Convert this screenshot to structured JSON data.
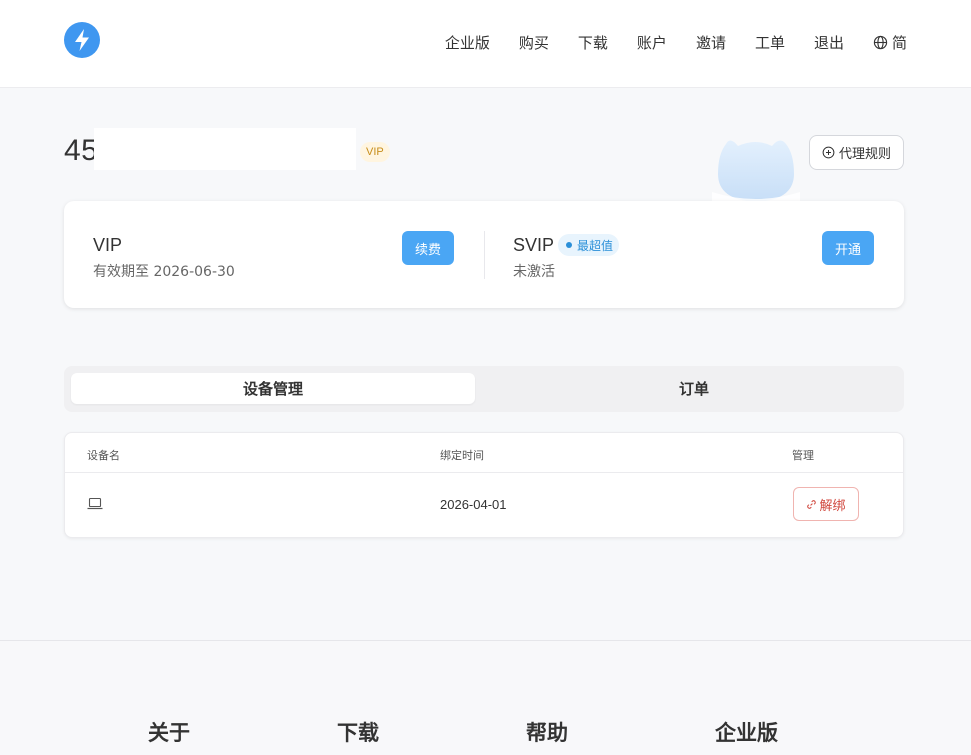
{
  "header": {
    "logo_icon": "bolt-icon",
    "brand_color": "#3f97f0",
    "nav": [
      "企业版",
      "购买",
      "下载",
      "账户",
      "邀请",
      "工单",
      "退出"
    ],
    "lang_icon": "globe-icon",
    "lang_label": "简"
  },
  "account": {
    "username_prefix": "45",
    "badge": "VIP",
    "proxy_rules_label": "代理规则"
  },
  "plans": {
    "vip": {
      "name": "VIP",
      "status": "有效期至 2026-06-30",
      "button": "续费"
    },
    "svip": {
      "name": "SVIP",
      "badge": "最超值",
      "status": "未激活",
      "button": "开通"
    },
    "accent_color": "#4aa6f4"
  },
  "tabs": [
    {
      "label": "设备管理",
      "active": true
    },
    {
      "label": "订单",
      "active": false
    }
  ],
  "devices": {
    "columns": [
      "设备名",
      "绑定时间",
      "管理"
    ],
    "rows": [
      {
        "device_icon": "laptop-icon",
        "bind_time": "2026-04-01",
        "action": "解绑"
      }
    ]
  },
  "footer": {
    "columns": [
      "关于",
      "下载",
      "帮助",
      "企业版"
    ]
  }
}
